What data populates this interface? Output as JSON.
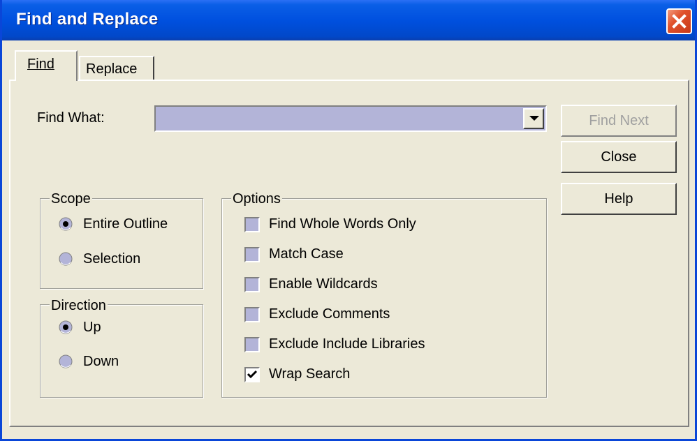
{
  "window": {
    "title": "Find and Replace"
  },
  "tabs": [
    {
      "label": "Find",
      "active": true
    },
    {
      "label": "Replace",
      "active": false
    }
  ],
  "find": {
    "label": "Find What:",
    "value": ""
  },
  "buttons": {
    "find_next": "Find Next",
    "close": "Close",
    "help": "Help"
  },
  "scope": {
    "title": "Scope",
    "options": [
      {
        "label": "Entire Outline",
        "selected": true
      },
      {
        "label": "Selection",
        "selected": false
      }
    ]
  },
  "direction": {
    "title": "Direction",
    "options": [
      {
        "label": "Up",
        "selected": true
      },
      {
        "label": "Down",
        "selected": false
      }
    ]
  },
  "options": {
    "title": "Options",
    "items": [
      {
        "label": "Find Whole Words Only",
        "checked": false
      },
      {
        "label": "Match Case",
        "checked": false
      },
      {
        "label": "Enable Wildcards",
        "checked": false
      },
      {
        "label": "Exclude Comments",
        "checked": false
      },
      {
        "label": "Exclude Include Libraries",
        "checked": false
      },
      {
        "label": "Wrap Search",
        "checked": true
      }
    ]
  },
  "colors": {
    "title_bar": "#0050df",
    "dialog_bg": "#ece9d8",
    "field_bg": "#b3b4d8",
    "close_button": "#e0522c"
  },
  "icons": {
    "close": "close-x-icon",
    "dropdown": "chevron-down-icon",
    "check": "checkmark-icon",
    "radio": "radio-dot-icon"
  }
}
